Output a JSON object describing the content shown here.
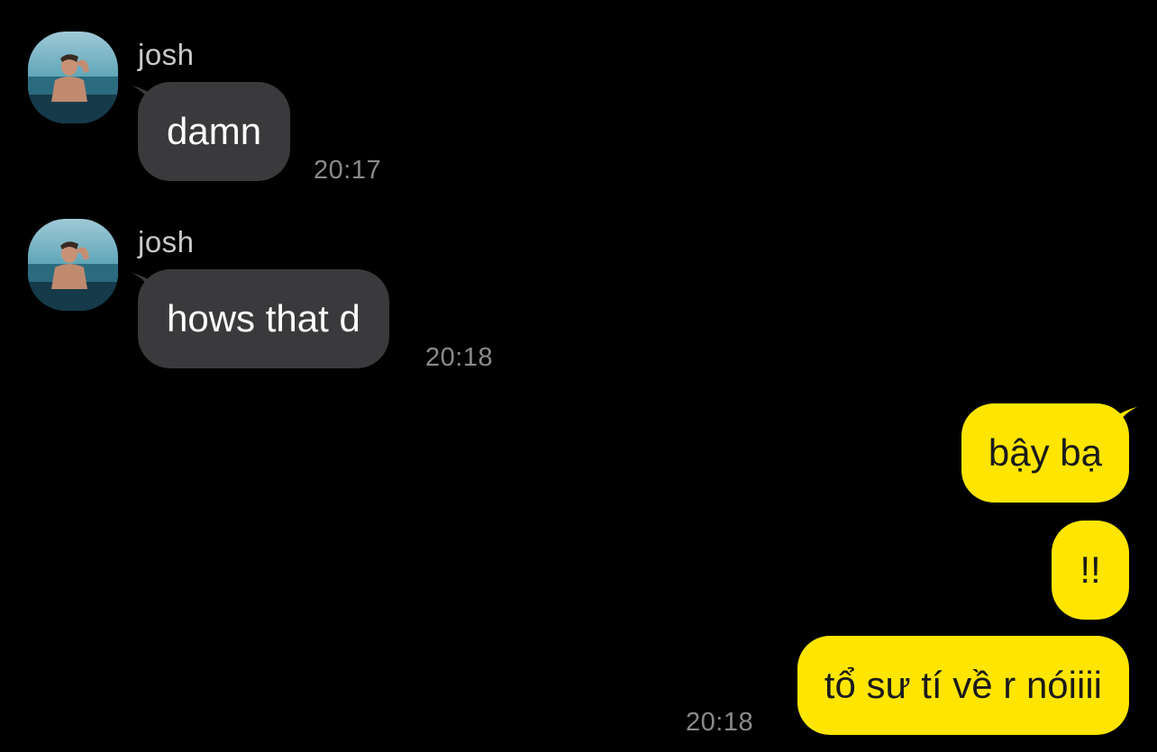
{
  "messages": [
    {
      "sender": "josh",
      "text": "damn",
      "time": "20:17"
    },
    {
      "sender": "josh",
      "text": "hows that d",
      "time": "20:18"
    }
  ],
  "outgoing": [
    {
      "text": "bậy bạ"
    },
    {
      "text": "!!"
    },
    {
      "text": "tổ sư tí về r nóiiii",
      "time": "20:18"
    }
  ],
  "colors": {
    "background": "#000000",
    "incoming_bubble": "#3a3a3c",
    "outgoing_bubble": "#ffe500",
    "timestamp": "#8a8a8a",
    "sender_name": "#c9c9c9"
  },
  "icons": {
    "avatar": "profile-photo-avatar"
  }
}
